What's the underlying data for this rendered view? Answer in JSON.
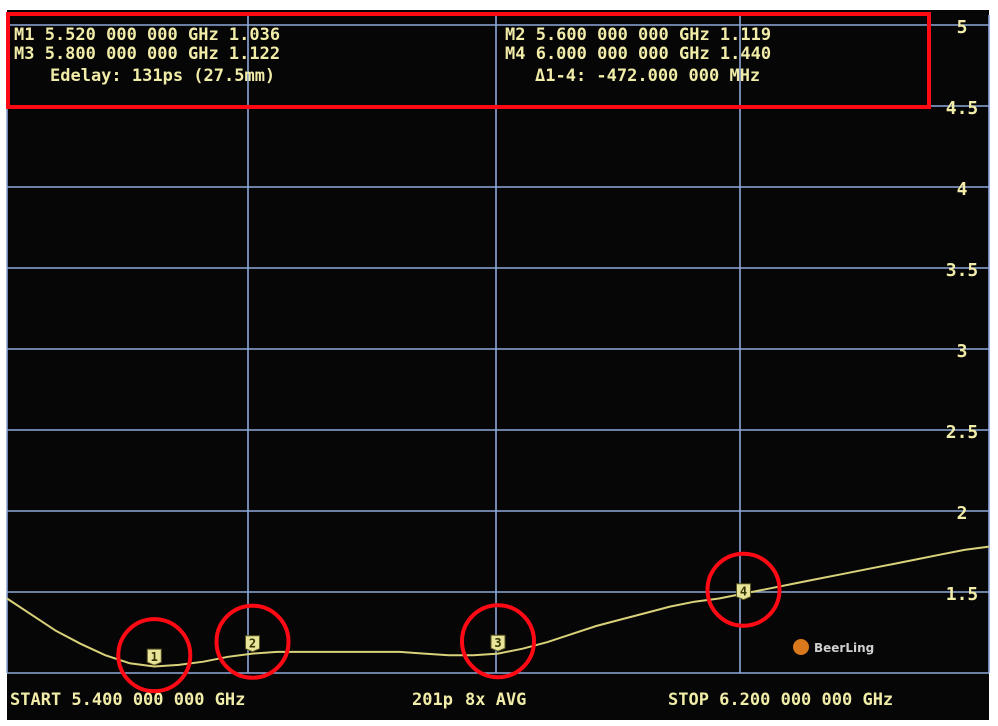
{
  "markers": [
    {
      "label": "M1 5.520 000 000 GHz 1.036"
    },
    {
      "label": "M3 5.800 000 000 GHz 1.122"
    },
    {
      "label": "M2 5.600 000 000 GHz 1.119"
    },
    {
      "label": "M4 6.000 000 000 GHz 1.440"
    }
  ],
  "edelay_label": "Edelay: 131ps (27.5mm)",
  "delta_label": "Δ1-4: -472.000 000 MHz",
  "footer": {
    "start_label": "START 5.400 000 000 GHz",
    "points_label": "201p",
    "avg_label": "8x AVG",
    "stop_label": "STOP 6.200 000 000 GHz"
  },
  "watermark": "BeerLing",
  "colors": {
    "background": "#060606",
    "grid": "#8ea7d9",
    "trace": "#d9d27a",
    "marker": "#e8e49a",
    "annotation": "#ff0a14",
    "text": "#f1eca8"
  },
  "chart_data": {
    "type": "line",
    "x_start_ghz": 5.4,
    "x_stop_ghz": 6.2,
    "ylim": [
      1,
      5
    ],
    "ytick_labels": [
      "5",
      "4.5",
      "4",
      "3.5",
      "3",
      "2.5",
      "2",
      "1.5"
    ],
    "grid": true,
    "series": [
      {
        "x": [
          5.4,
          5.42,
          5.44,
          5.46,
          5.48,
          5.5,
          5.52,
          5.54,
          5.56,
          5.58,
          5.6,
          5.62,
          5.64,
          5.66,
          5.68,
          5.7,
          5.72,
          5.74,
          5.76,
          5.78,
          5.8,
          5.82,
          5.84,
          5.86,
          5.88,
          5.9,
          5.92,
          5.94,
          5.96,
          5.98,
          6.0,
          6.02,
          6.04,
          6.06,
          6.08,
          6.1,
          6.12,
          6.14,
          6.16,
          6.18,
          6.2
        ],
        "y": [
          1.46,
          1.36,
          1.26,
          1.18,
          1.11,
          1.06,
          1.04,
          1.05,
          1.07,
          1.1,
          1.12,
          1.13,
          1.13,
          1.13,
          1.13,
          1.13,
          1.13,
          1.12,
          1.11,
          1.11,
          1.12,
          1.15,
          1.19,
          1.24,
          1.29,
          1.33,
          1.37,
          1.41,
          1.44,
          1.46,
          1.49,
          1.52,
          1.55,
          1.58,
          1.61,
          1.64,
          1.67,
          1.7,
          1.73,
          1.76,
          1.78
        ]
      }
    ],
    "marker_points": [
      {
        "id": "1",
        "x": 5.52,
        "y": 1.036
      },
      {
        "id": "2",
        "x": 5.6,
        "y": 1.119
      },
      {
        "id": "3",
        "x": 5.8,
        "y": 1.122
      },
      {
        "id": "4",
        "x": 6.0,
        "y": 1.44
      }
    ]
  }
}
